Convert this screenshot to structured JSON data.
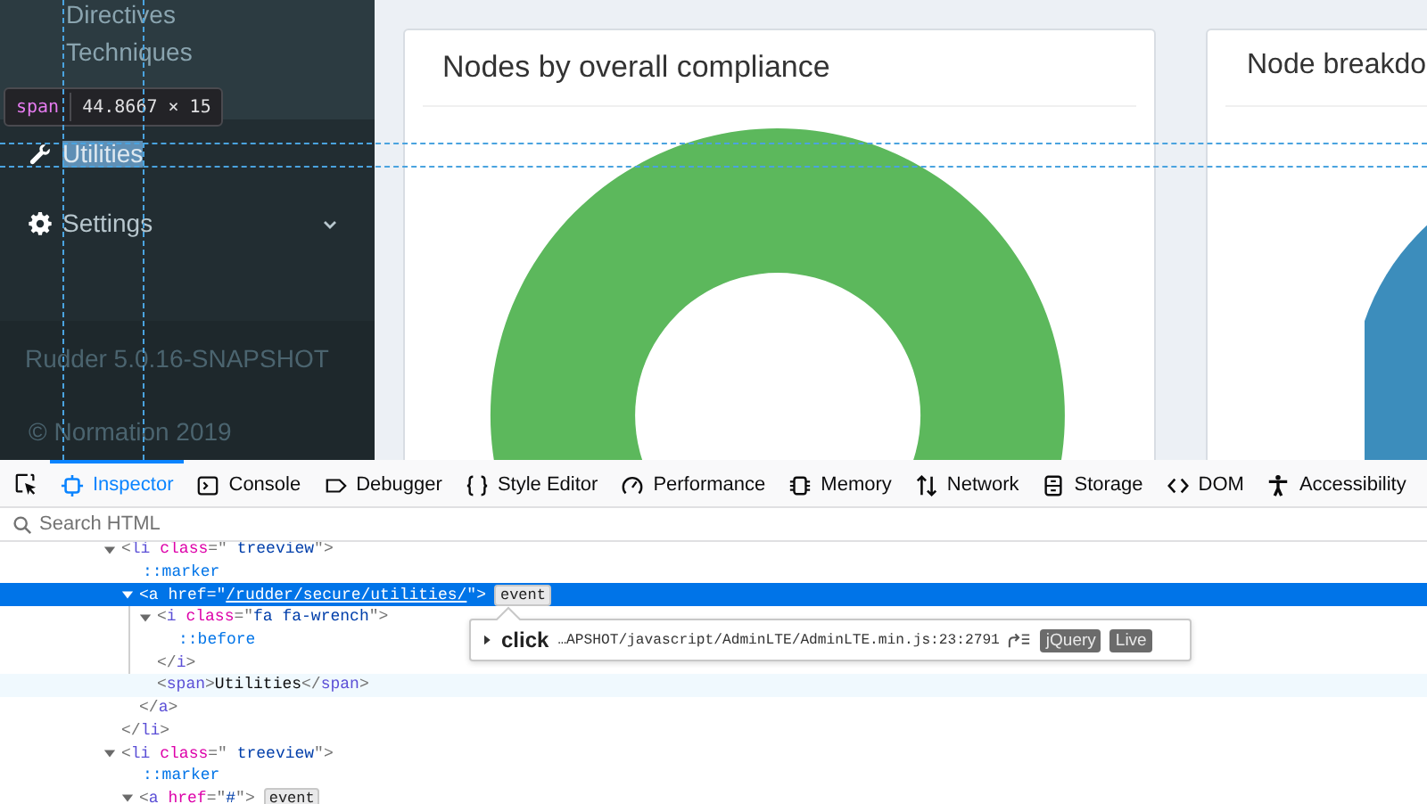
{
  "sidebar": {
    "items": [
      {
        "label": "Directives",
        "kind": "sub",
        "highlighted": false
      },
      {
        "label": "Techniques",
        "kind": "sub",
        "highlighted": false
      },
      {
        "label": "Utilities",
        "kind": "menu",
        "highlighted": true
      },
      {
        "label": "Settings",
        "kind": "menu",
        "highlighted": false,
        "expanded": false
      }
    ],
    "version": "Rudder 5.0.16-SNAPSHOT",
    "copyright": "© Normation 2019"
  },
  "inspector_tooltip": {
    "tag": "span",
    "size": "44.8667 × 15"
  },
  "cards": [
    {
      "title": "Nodes by overall compliance"
    },
    {
      "title": "Node breakdo"
    }
  ],
  "devtools": {
    "tabs": [
      {
        "label": "Inspector",
        "selected": true
      },
      {
        "label": "Console",
        "selected": false
      },
      {
        "label": "Debugger",
        "selected": false
      },
      {
        "label": "Style Editor",
        "selected": false
      },
      {
        "label": "Performance",
        "selected": false
      },
      {
        "label": "Memory",
        "selected": false
      },
      {
        "label": "Network",
        "selected": false
      },
      {
        "label": "Storage",
        "selected": false
      },
      {
        "label": "DOM",
        "selected": false
      },
      {
        "label": "Accessibility",
        "selected": false
      }
    ],
    "search": {
      "placeholder": "Search HTML"
    },
    "markup": [
      {
        "kind": "element",
        "selected": false,
        "hovered": false,
        "expanded": true,
        "parts": [
          {
            "kind": "punct",
            "text": "<"
          },
          {
            "kind": "tag",
            "text": "li"
          },
          {
            "kind": "attr",
            "text": " class"
          },
          {
            "kind": "punct",
            "text": "=\""
          },
          {
            "kind": "value",
            "text": " treeview"
          },
          {
            "kind": "punct",
            "text": "\">"
          }
        ],
        "closing": [
          {
            "kind": "punct",
            "text": "</"
          },
          {
            "kind": "tag",
            "text": "li"
          },
          {
            "kind": "punct",
            "text": ">"
          }
        ],
        "children": [
          {
            "kind": "pseudo",
            "selected": false,
            "hovered": false,
            "parts": [
              {
                "kind": "pseudo",
                "text": "::marker"
              }
            ]
          },
          {
            "kind": "element",
            "selected": true,
            "hovered": false,
            "expanded": true,
            "event": "event",
            "parts": [
              {
                "kind": "punct",
                "text": "<"
              },
              {
                "kind": "tag",
                "text": "a"
              },
              {
                "kind": "attr",
                "text": " href"
              },
              {
                "kind": "punct",
                "text": "=\""
              },
              {
                "kind": "link",
                "text": "/rudder/secure/utilities/"
              },
              {
                "kind": "punct",
                "text": "\">"
              }
            ],
            "closing": [
              {
                "kind": "punct",
                "text": "</"
              },
              {
                "kind": "tag",
                "text": "a"
              },
              {
                "kind": "punct",
                "text": ">"
              }
            ],
            "children": [
              {
                "kind": "element",
                "selected": false,
                "hovered": false,
                "expanded": true,
                "parts": [
                  {
                    "kind": "punct",
                    "text": "<"
                  },
                  {
                    "kind": "tag",
                    "text": "i"
                  },
                  {
                    "kind": "attr",
                    "text": " class"
                  },
                  {
                    "kind": "punct",
                    "text": "=\""
                  },
                  {
                    "kind": "value",
                    "text": "fa fa-wrench"
                  },
                  {
                    "kind": "punct",
                    "text": "\">"
                  }
                ],
                "closing": [
                  {
                    "kind": "punct",
                    "text": "</"
                  },
                  {
                    "kind": "tag",
                    "text": "i"
                  },
                  {
                    "kind": "punct",
                    "text": ">"
                  }
                ],
                "children": [
                  {
                    "kind": "pseudo",
                    "selected": false,
                    "hovered": false,
                    "parts": [
                      {
                        "kind": "pseudo",
                        "text": "::before"
                      }
                    ]
                  }
                ]
              },
              {
                "kind": "element",
                "selected": false,
                "hovered": true,
                "parts": [
                  {
                    "kind": "punct",
                    "text": "<"
                  },
                  {
                    "kind": "tag",
                    "text": "span"
                  },
                  {
                    "kind": "punct",
                    "text": ">"
                  },
                  {
                    "kind": "text",
                    "text": "Utilities"
                  },
                  {
                    "kind": "punct",
                    "text": "</"
                  },
                  {
                    "kind": "tag",
                    "text": "span"
                  },
                  {
                    "kind": "punct",
                    "text": ">"
                  }
                ]
              }
            ]
          }
        ]
      },
      {
        "kind": "element",
        "selected": false,
        "hovered": false,
        "expanded": true,
        "parts": [
          {
            "kind": "punct",
            "text": "<"
          },
          {
            "kind": "tag",
            "text": "li"
          },
          {
            "kind": "attr",
            "text": " class"
          },
          {
            "kind": "punct",
            "text": "=\""
          },
          {
            "kind": "value",
            "text": " treeview"
          },
          {
            "kind": "punct",
            "text": "\">"
          }
        ],
        "children": [
          {
            "kind": "pseudo",
            "selected": false,
            "hovered": false,
            "parts": [
              {
                "kind": "pseudo",
                "text": "::marker"
              }
            ]
          },
          {
            "kind": "element",
            "selected": false,
            "hovered": false,
            "expanded": true,
            "event": "event",
            "parts": [
              {
                "kind": "punct",
                "text": "<"
              },
              {
                "kind": "tag",
                "text": "a"
              },
              {
                "kind": "attr",
                "text": " href"
              },
              {
                "kind": "punct",
                "text": "=\""
              },
              {
                "kind": "link",
                "text": "#"
              },
              {
                "kind": "punct",
                "text": "\">"
              }
            ]
          }
        ]
      }
    ],
    "event_popup": {
      "expanded": false,
      "event_type": "click",
      "source": "…APSHOT/javascript/AdminLTE/AdminLTE.min.js:23:2791",
      "tags": [
        "jQuery",
        "Live"
      ]
    }
  }
}
